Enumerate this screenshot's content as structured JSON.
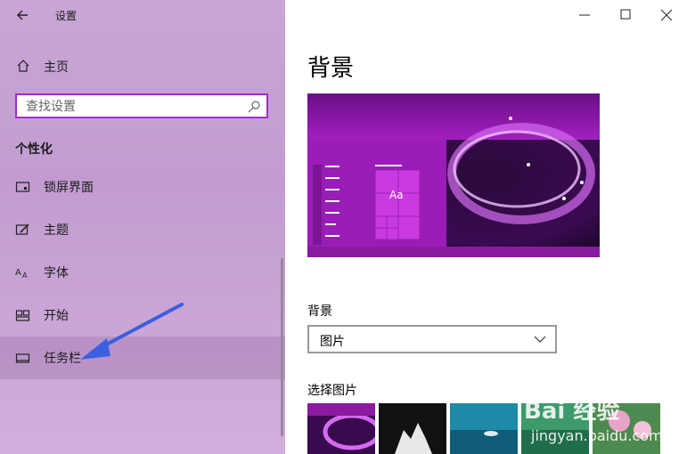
{
  "sidebar": {
    "app_title": "设置",
    "home_label": "主页",
    "search_placeholder": "查找设置",
    "section_title": "个性化",
    "items": [
      {
        "label": "锁屏界面",
        "icon": "lock-screen-icon"
      },
      {
        "label": "主题",
        "icon": "theme-brush-icon"
      },
      {
        "label": "字体",
        "icon": "font-icon"
      },
      {
        "label": "开始",
        "icon": "start-icon"
      },
      {
        "label": "任务栏",
        "icon": "taskbar-icon"
      }
    ],
    "active_item": "任务栏"
  },
  "main": {
    "page_title": "背景",
    "background_label": "背景",
    "background_value": "图片",
    "choose_picture_label": "选择图片"
  },
  "watermark": {
    "logo_text": "Bai 经验",
    "url": "jingyan.baidu.com"
  },
  "colors": {
    "accent": "#a02fc8",
    "sidebar_bg": "#c6a2d4",
    "preview_purple": "#8a1aa0"
  }
}
